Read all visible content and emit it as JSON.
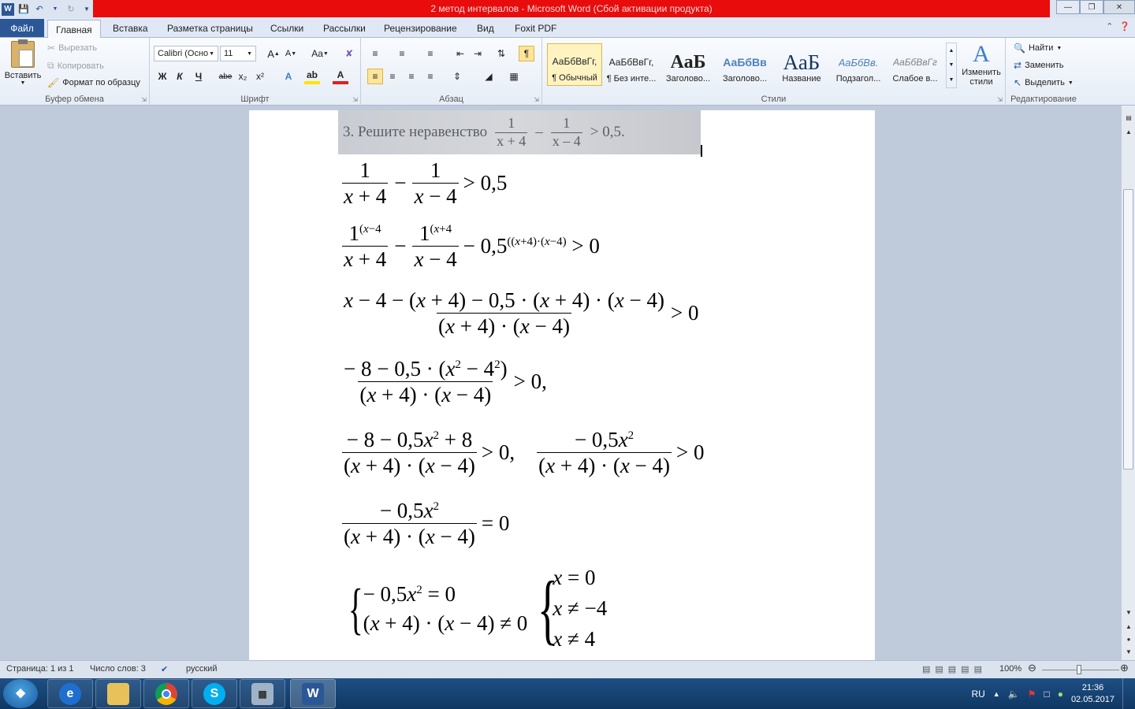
{
  "window": {
    "title": "2 метод интервалов  -  Microsoft Word (Сбой активации продукта)"
  },
  "tabs": [
    "Файл",
    "Главная",
    "Вставка",
    "Разметка страницы",
    "Ссылки",
    "Рассылки",
    "Рецензирование",
    "Вид",
    "Foxit PDF"
  ],
  "ribbon": {
    "clipboard": {
      "paste": "Вставить",
      "cut": "Вырезать",
      "copy": "Копировать",
      "format_painter": "Формат по образцу",
      "label": "Буфер обмена"
    },
    "font": {
      "name": "Calibri (Осно",
      "size": "11",
      "label": "Шрифт",
      "bold": "Ж",
      "italic": "К",
      "underline": "Ч",
      "strike": "abe",
      "grow": "A",
      "shrink": "A",
      "case": "Aa"
    },
    "paragraph": {
      "label": "Абзац"
    },
    "styles": {
      "label": "Стили",
      "items": [
        {
          "preview": "АаБбВвГг,",
          "name": "¶ Обычный"
        },
        {
          "preview": "АаБбВвГг,",
          "name": "¶ Без инте..."
        },
        {
          "preview": "АаБ",
          "name": "Заголово..."
        },
        {
          "preview": "АаБбВв",
          "name": "Заголово..."
        },
        {
          "preview": "АаБ",
          "name": "Название"
        },
        {
          "preview": "АаБбВв.",
          "name": "Подзагол..."
        },
        {
          "preview": "АаБбВвГг",
          "name": "Слабое в..."
        }
      ],
      "change": "Изменить стили"
    },
    "editing": {
      "find": "Найти",
      "replace": "Заменить",
      "select": "Выделить",
      "label": "Редактирование"
    }
  },
  "document": {
    "textbook_line": "3.  Решите неравенство",
    "textbook_ineq": "> 0,5."
  },
  "status": {
    "page": "Страница: 1 из 1",
    "words": "Число слов: 3",
    "lang": "русский",
    "zoom": "100%"
  },
  "taskbar": {
    "lang": "RU",
    "time": "21:36",
    "date": "02.05.2017"
  }
}
